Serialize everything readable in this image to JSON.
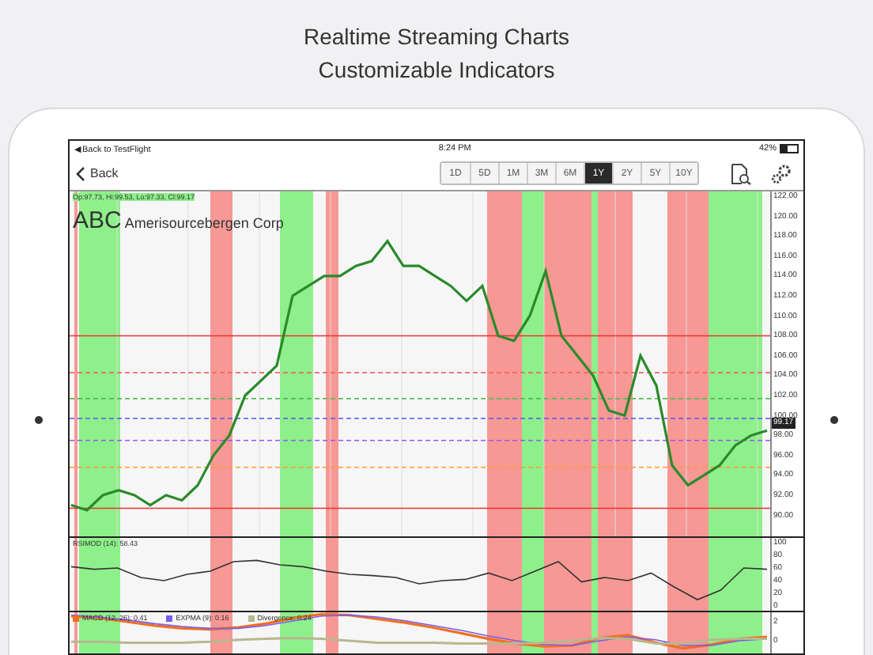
{
  "headline": [
    "Realtime Streaming Charts",
    "Customizable Indicators"
  ],
  "status_bar": {
    "back_link": "◀Back to TestFlight",
    "time": "8:24 PM",
    "battery": "42%"
  },
  "toolbar": {
    "back": "Back",
    "periods": [
      {
        "label": "1D",
        "selected": false
      },
      {
        "label": "5D",
        "selected": false
      },
      {
        "label": "1M",
        "selected": false
      },
      {
        "label": "3M",
        "selected": false
      },
      {
        "label": "6M",
        "selected": false
      },
      {
        "label": "1Y",
        "selected": true
      },
      {
        "label": "2Y",
        "selected": false
      },
      {
        "label": "5Y",
        "selected": false
      },
      {
        "label": "10Y",
        "selected": false
      }
    ]
  },
  "price_chart": {
    "quote": "Op:97.73, Hi:99.53, Lo:97.33, Cl:99.17",
    "ticker": "ABC",
    "company": "Amerisourcebergen Corp",
    "current_price": "99.17",
    "chart_data": {
      "type": "line",
      "ylim": [
        87.88,
        122.48
      ],
      "grid": true,
      "yticks": [
        {
          "value": 122,
          "label": "122.00"
        },
        {
          "value": 120,
          "label": "120.00"
        },
        {
          "value": 118,
          "label": "118.00"
        },
        {
          "value": 116,
          "label": "116.00"
        },
        {
          "value": 114,
          "label": "114.00"
        },
        {
          "value": 112,
          "label": "112.00"
        },
        {
          "value": 110,
          "label": "110.00"
        },
        {
          "value": 108,
          "label": "108.00"
        },
        {
          "value": 106,
          "label": "106.00"
        },
        {
          "value": 104,
          "label": "104.00"
        },
        {
          "value": 102,
          "label": "102.00"
        },
        {
          "value": 100,
          "label": "100.00"
        },
        {
          "value": 98,
          "label": "98.00"
        },
        {
          "value": 96,
          "label": "96.00"
        },
        {
          "value": 94,
          "label": "94.00"
        },
        {
          "value": 92,
          "label": "92.00"
        },
        {
          "value": 90,
          "label": "90.00"
        }
      ],
      "series": [
        {
          "color": "#2a8a2a",
          "values": [
            91,
            90.5,
            92,
            92.5,
            92,
            91,
            92,
            91.5,
            93,
            96,
            98,
            102,
            103.5,
            105,
            112,
            113,
            114,
            114,
            115,
            115.5,
            117.5,
            115,
            115,
            114,
            113,
            111.5,
            113,
            108,
            107.5,
            110,
            114.5,
            108,
            106,
            104,
            100.5,
            100,
            106,
            103,
            95,
            93,
            94,
            95,
            97,
            98,
            98.5
          ]
        }
      ]
    }
  },
  "rsi_panel": {
    "legend": "RSIMOD (14): 58.43",
    "chart_data": {
      "type": "line",
      "ylim": [
        -7.5,
        107.5
      ],
      "yticks": [
        {
          "value": 100,
          "label": "100"
        },
        {
          "value": 80,
          "label": "80"
        },
        {
          "value": 60,
          "label": "60"
        },
        {
          "value": 40,
          "label": "40"
        },
        {
          "value": 20,
          "label": "20"
        },
        {
          "value": 0,
          "label": "0"
        }
      ],
      "series": [
        {
          "color": "#333333",
          "values": [
            62,
            58,
            60,
            45,
            40,
            50,
            55,
            70,
            72,
            65,
            62,
            55,
            50,
            48,
            45,
            35,
            40,
            42,
            52,
            40,
            55,
            70,
            38,
            45,
            40,
            52,
            30,
            10,
            25,
            60,
            58
          ]
        }
      ]
    }
  },
  "macd_panel": {
    "legends": [
      "MACD (12, 26): 0.41",
      "EXPMA (9): 0.16",
      "Divergence: 0.24"
    ],
    "chart_data": {
      "type": "line",
      "ylim": [
        -1.33,
        3
      ],
      "yticks": [
        {
          "value": 2,
          "label": "2"
        },
        {
          "value": 0,
          "label": "0"
        }
      ],
      "series": [
        {
          "color": "#f07020",
          "values": [
            2.6,
            2.4,
            2,
            1.6,
            1.3,
            1.2,
            1.4,
            1.8,
            2.4,
            2.8,
            2.7,
            2.3,
            1.9,
            1.4,
            0.8,
            0.2,
            -0.3,
            -0.6,
            -0.5,
            0.3,
            0.6,
            -0.2,
            -0.8,
            -0.4,
            0.2,
            0.4
          ]
        },
        {
          "color": "#7a5cf0",
          "values": [
            2.7,
            2.5,
            2.2,
            1.8,
            1.5,
            1.3,
            1.3,
            1.6,
            2.1,
            2.6,
            2.7,
            2.5,
            2.1,
            1.6,
            1.1,
            0.5,
            0,
            -0.4,
            -0.5,
            0,
            0.4,
            0.1,
            -0.5,
            -0.5,
            0,
            0.2
          ]
        },
        {
          "color": "#b8b890",
          "values": [
            -0.1,
            -0.1,
            -0.2,
            -0.2,
            -0.2,
            -0.1,
            0.1,
            0.2,
            0.3,
            0.2,
            0,
            -0.2,
            -0.2,
            -0.2,
            -0.3,
            -0.3,
            -0.3,
            -0.2,
            0,
            0.3,
            0.2,
            -0.3,
            -0.3,
            0.1,
            0.2,
            0.2
          ]
        }
      ]
    }
  }
}
